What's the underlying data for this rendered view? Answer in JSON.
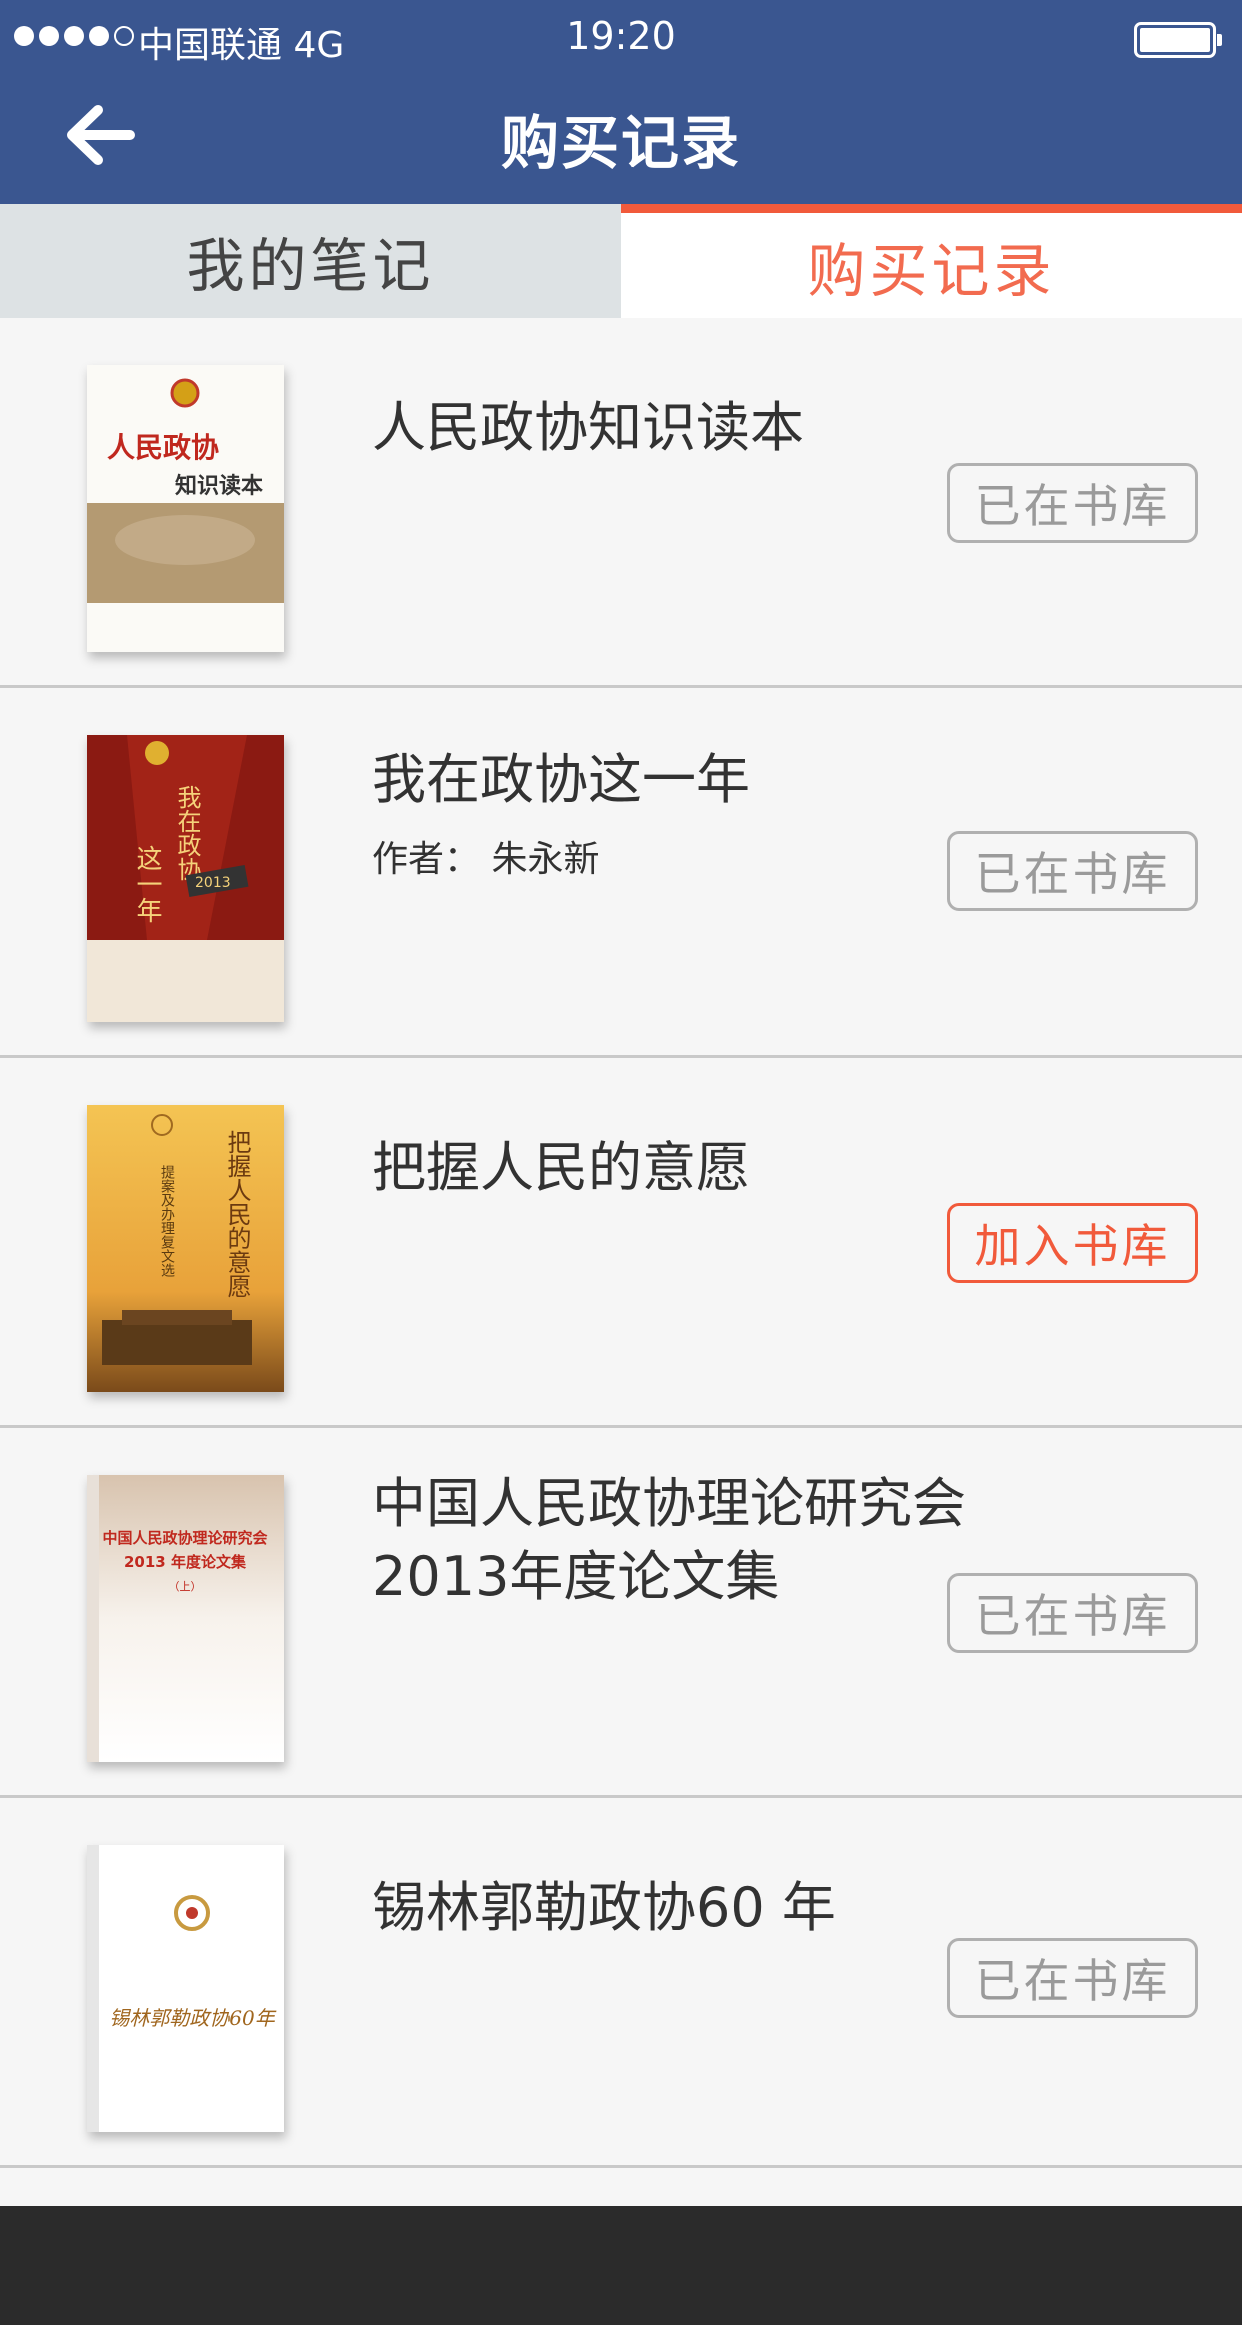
{
  "status": {
    "carrier": "中国联通  4G",
    "time": "19:20"
  },
  "nav": {
    "title": "购买记录"
  },
  "tabs": [
    {
      "label": "我的笔记"
    },
    {
      "label": "购买记录"
    }
  ],
  "colors": {
    "header": "#3a5690",
    "accent": "#f15a3b",
    "text": "#323232",
    "tab_inactive_bg": "#dde2e4"
  },
  "books": [
    {
      "title": "人民政协知识读本",
      "author": "",
      "button": "已在书库",
      "cover_text": [
        "人民政协",
        "知识读本"
      ]
    },
    {
      "title": "我在政协这一年",
      "author": "作者：  朱永新",
      "button": "已在书库",
      "cover_text": [
        "我在政协",
        "这一年",
        "2013"
      ]
    },
    {
      "title": "把握人民的意愿",
      "author": "",
      "button": "加入书库",
      "cover_text": [
        "把握人民的意愿",
        "提案及办理复文选"
      ]
    },
    {
      "title": "中国人民政协理论研究会\n2013年度论文集",
      "author": "",
      "button": "已在书库",
      "cover_text": [
        "中国人民政协理论研究会",
        "2013 年度论文集",
        "（上）"
      ]
    },
    {
      "title": "锡林郭勒政协60 年",
      "author": "",
      "button": "已在书库",
      "cover_text": [
        "锡林郭勒政协60年"
      ]
    }
  ]
}
